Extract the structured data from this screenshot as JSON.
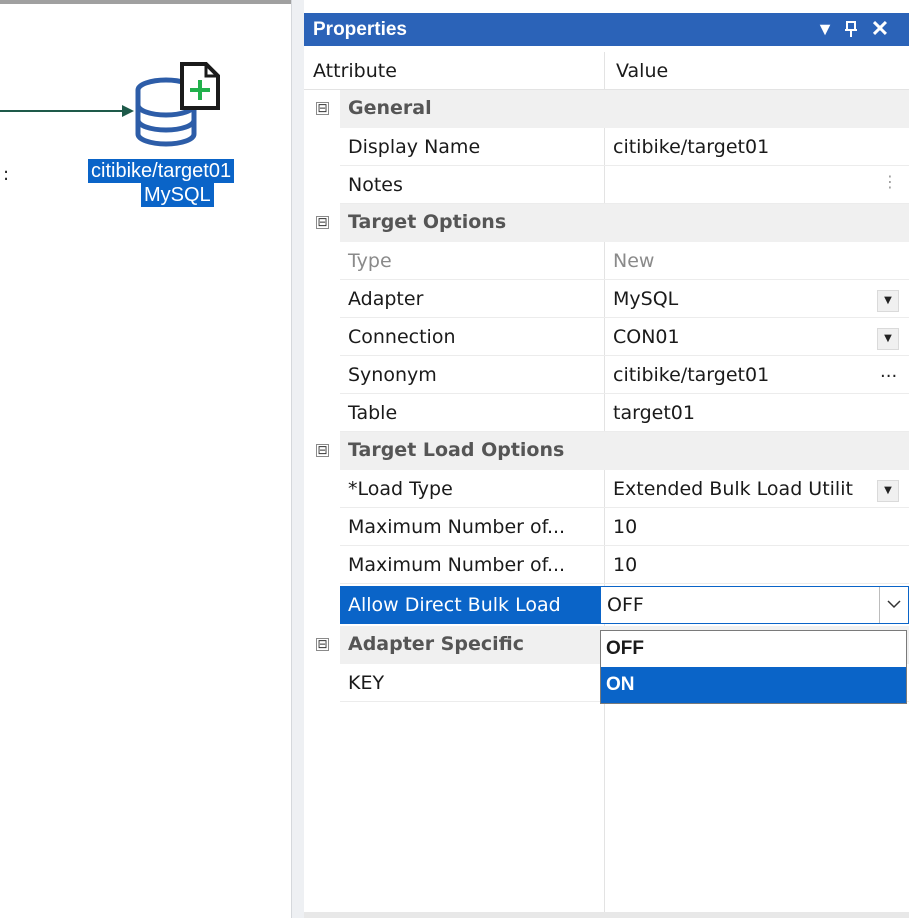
{
  "canvas": {
    "node": {
      "line1": "citibike/target01",
      "line2": "MySQL"
    },
    "fragment": ":"
  },
  "panel": {
    "title": "Properties",
    "header": {
      "attribute": "Attribute",
      "value": "Value"
    },
    "categories": {
      "general": "General",
      "target_options": "Target Options",
      "target_load_options": "Target Load Options",
      "adapter_specific": "Adapter Specific"
    },
    "rows": {
      "display_name": {
        "attr": "Display Name",
        "value": "citibike/target01"
      },
      "notes": {
        "attr": "Notes",
        "value": ""
      },
      "type": {
        "attr": "Type",
        "value": "New"
      },
      "adapter": {
        "attr": "Adapter",
        "value": "MySQL"
      },
      "connection": {
        "attr": "Connection",
        "value": "CON01"
      },
      "synonym": {
        "attr": "Synonym",
        "value": "citibike/target01"
      },
      "table": {
        "attr": "Table",
        "value": "target01"
      },
      "load_type": {
        "attr": "*Load Type",
        "value": "Extended Bulk Load Utilit"
      },
      "max1": {
        "attr": "Maximum Number of...",
        "value": "10"
      },
      "max2": {
        "attr": "Maximum Number of...",
        "value": "10"
      },
      "allow_direct": {
        "attr": "Allow Direct Bulk Load",
        "value": "OFF"
      },
      "key": {
        "attr": "KEY",
        "value": ""
      }
    },
    "dropdown_options": [
      "OFF",
      "ON"
    ],
    "icons": {
      "collapse": "⊟",
      "dropdown_arrow": "▼",
      "pin": "ᴨ",
      "close": "✕",
      "ellipsis": "...",
      "more": "⋮"
    }
  }
}
